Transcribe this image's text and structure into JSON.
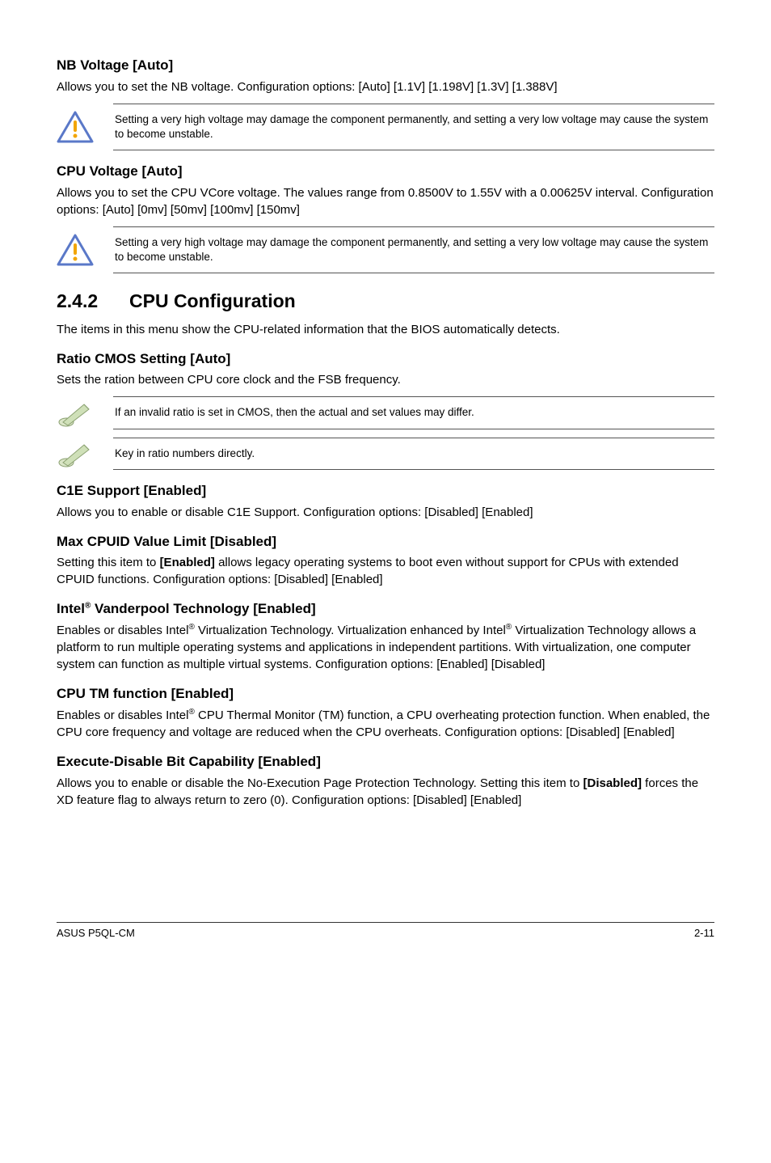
{
  "nb_voltage": {
    "heading": "NB Voltage [Auto]",
    "para": "Allows you to set the NB voltage. Configuration options: [Auto] [1.1V] [1.198V] [1.3V] [1.388V]"
  },
  "warn1": "Setting a very high voltage may damage the component permanently, and setting a very low voltage may cause the system to become unstable.",
  "cpu_voltage": {
    "heading": "CPU Voltage [Auto]",
    "para": "Allows you to set the CPU VCore voltage. The values range from 0.8500V to 1.55V with a 0.00625V interval. Configuration options: [Auto] [0mv] [50mv] [100mv] [150mv]"
  },
  "warn2": "Setting a very high voltage may damage the component permanently, and setting a very low voltage may cause the system to become unstable.",
  "section": {
    "num": "2.4.2",
    "title": "CPU Configuration",
    "para": "The items in this menu show the CPU-related information that the BIOS automatically detects."
  },
  "ratio_cmos": {
    "heading": "Ratio CMOS Setting [Auto]",
    "para": "Sets the ration between CPU core clock and the FSB frequency."
  },
  "note1": "If an invalid ratio is set in CMOS, then the actual and set values may differ.",
  "note2": "Key in ratio numbers directly.",
  "c1e": {
    "heading": "C1E Support [Enabled]",
    "para": "Allows you to enable or disable C1E Support. Configuration options: [Disabled] [Enabled]"
  },
  "max_cpuid": {
    "heading": "Max CPUID Value Limit [Disabled]",
    "para_before": "Setting this item to ",
    "bold": "[Enabled]",
    "para_after": " allows legacy operating systems to boot even without support for CPUs with extended CPUID functions. Configuration options: [Disabled] [Enabled]"
  },
  "vanderpool": {
    "heading_before": "Intel",
    "heading_sup": "®",
    "heading_after": " Vanderpool Technology [Enabled]",
    "para_before": "Enables or disables Intel",
    "sup1": "®",
    "para_mid1": " Virtualization Technology. Virtualization enhanced by Intel",
    "sup2": "®",
    "para_after": " Virtualization Technology allows a platform to run multiple operating systems and applications in independent partitions. With virtualization, one computer system can function as multiple virtual systems. Configuration options: [Enabled] [Disabled]"
  },
  "cpu_tm": {
    "heading": "CPU TM function [Enabled]",
    "para_before": "Enables or disables Intel",
    "sup": "®",
    "para_after": " CPU Thermal Monitor (TM) function, a CPU overheating  protection function. When enabled, the CPU core frequency and voltage are reduced when the CPU overheats. Configuration options: [Disabled] [Enabled]"
  },
  "exec_disable": {
    "heading": "Execute-Disable Bit Capability [Enabled]",
    "para_before": "Allows you to enable or disable the No-Execution Page Protection Technology. Setting this item to ",
    "bold": "[Disabled]",
    "para_after": " forces the XD feature flag to always return to zero (0). Configuration options: [Disabled] [Enabled]"
  },
  "footer": {
    "left": "ASUS P5QL-CM",
    "right": "2-11"
  }
}
